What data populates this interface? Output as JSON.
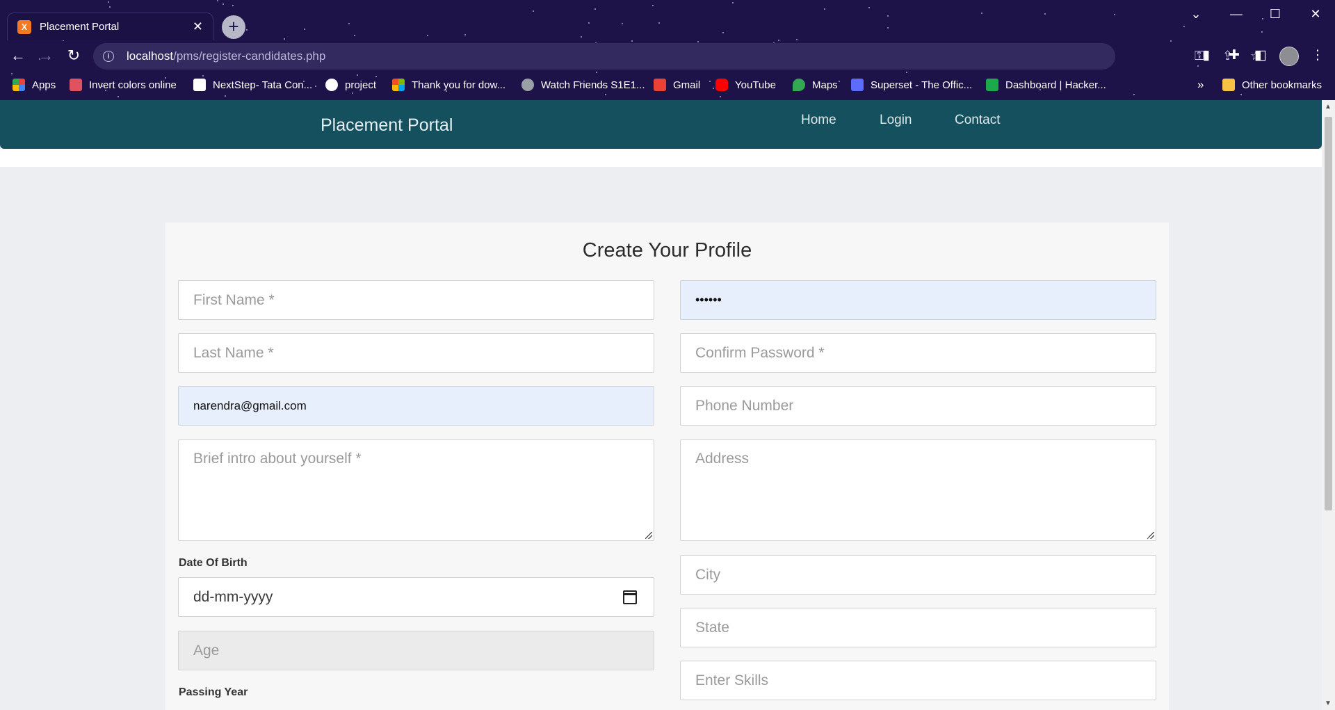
{
  "browser": {
    "tab": {
      "favicon_text": "X",
      "title": "Placement Portal",
      "close": "✕"
    },
    "new_tab": "+",
    "window_controls": {
      "list": "⌄",
      "minimize": "—",
      "maximize": "☐",
      "close": "✕"
    },
    "nav": {
      "back": "←",
      "forward": "→",
      "reload": "↻"
    },
    "url": {
      "host": "localhost",
      "path": "/pms/register-candidates.php"
    },
    "omnibox_icons": [
      "key-icon",
      "share-icon",
      "star-icon"
    ],
    "toolbar_icons": [
      "extension-note-icon",
      "puzzle-icon",
      "sidepanel-icon",
      "profile-avatar",
      "menu-icon"
    ],
    "bookmarks": [
      {
        "label": "Apps",
        "color": "#e8453c"
      },
      {
        "label": "Invert colors online",
        "color": "#e05260"
      },
      {
        "label": "NextStep- Tata Con...",
        "color": "#ffffff"
      },
      {
        "label": "project",
        "color": "#ffffff"
      },
      {
        "label": "Thank you for dow...",
        "color": "#f25022"
      },
      {
        "label": "Watch Friends S1E1...",
        "color": "#9aa0a6"
      },
      {
        "label": "Gmail",
        "color": "#ea4335"
      },
      {
        "label": "YouTube",
        "color": "#ff0000"
      },
      {
        "label": "Maps",
        "color": "#34a853"
      },
      {
        "label": "Superset - The Offic...",
        "color": "#5b6cff"
      },
      {
        "label": "Dashboard | Hacker...",
        "color": "#1ba94c"
      }
    ],
    "more_bookmarks": "»",
    "other_bookmarks": "Other bookmarks"
  },
  "site": {
    "brand": "Placement Portal",
    "nav": [
      "Home",
      "Login",
      "Contact"
    ]
  },
  "form": {
    "heading": "Create Your Profile",
    "first_name_placeholder": "First Name *",
    "last_name_placeholder": "Last Name *",
    "email_value": "narendra@gmail.com",
    "intro_placeholder": "Brief intro about yourself *",
    "dob_label": "Date Of Birth",
    "dob_placeholder": "dd-mm-yyyy",
    "age_placeholder": "Age",
    "passing_year_label": "Passing Year",
    "password_value": "••••••",
    "confirm_password_placeholder": "Confirm Password *",
    "phone_placeholder": "Phone Number",
    "address_placeholder": "Address",
    "city_placeholder": "City",
    "state_placeholder": "State",
    "skills_placeholder": "Enter Skills"
  },
  "colors": {
    "chrome_bg": "#1d1349",
    "navbar": "#14505e",
    "autofill": "#e7effc"
  }
}
